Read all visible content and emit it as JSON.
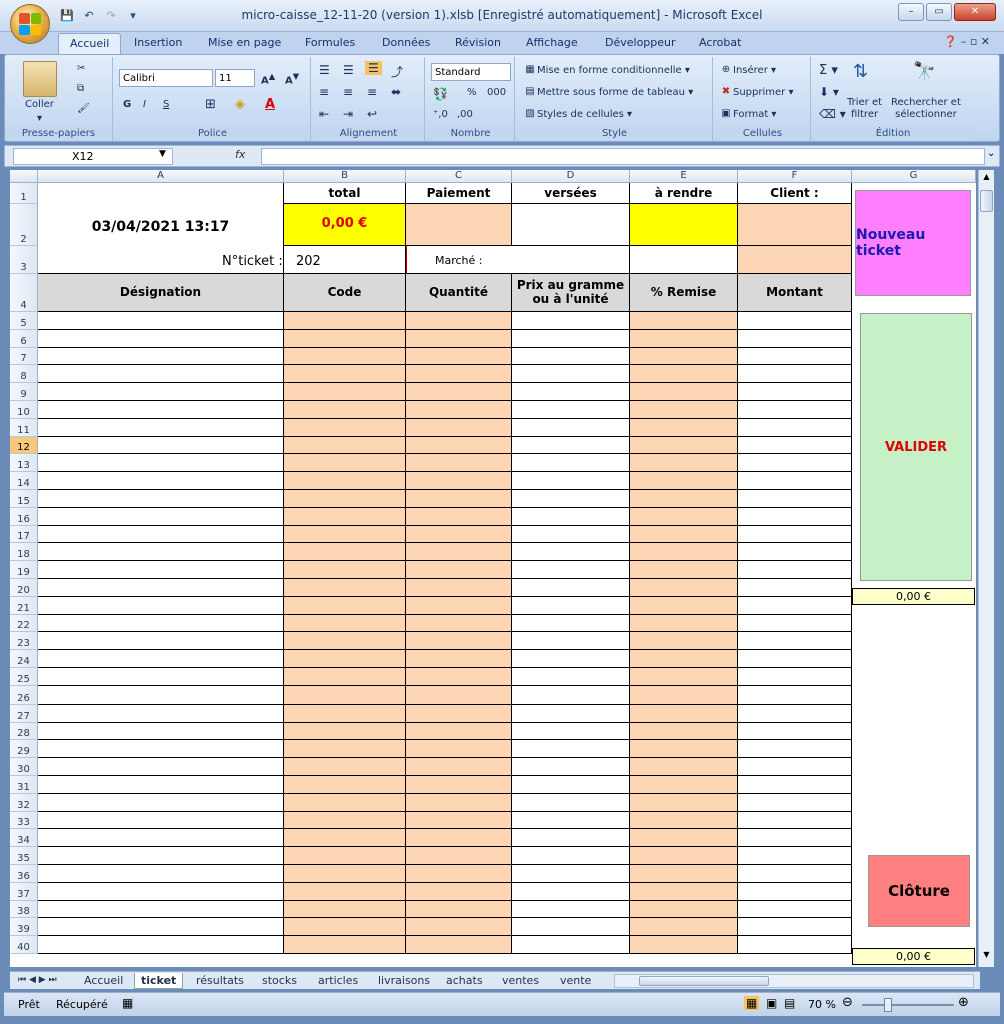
{
  "window": {
    "title": "micro-caisse_12-11-20 (version 1).xlsb [Enregistré automatiquement] - Microsoft Excel",
    "controls": [
      "–",
      "▭",
      "✕"
    ]
  },
  "ribbon": {
    "tabs": [
      "Accueil",
      "Insertion",
      "Mise en page",
      "Formules",
      "Données",
      "Révision",
      "Affichage",
      "Développeur",
      "Acrobat"
    ],
    "active_tab": "Accueil",
    "groups": {
      "clipboard": {
        "label": "Presse-papiers",
        "paste": "Coller"
      },
      "font": {
        "label": "Police",
        "font_name": "Calibri",
        "font_size": "11",
        "bold": "G",
        "italic": "I",
        "underline": "S"
      },
      "alignment": {
        "label": "Alignement"
      },
      "number": {
        "label": "Nombre",
        "format": "Standard",
        "percent": "%",
        "thousands": "000"
      },
      "style": {
        "label": "Style",
        "cond_format": "Mise en forme conditionnelle",
        "as_table": "Mettre sous forme de tableau",
        "cell_styles": "Styles de cellules"
      },
      "cells": {
        "label": "Cellules",
        "insert": "Insérer",
        "delete": "Supprimer",
        "format": "Format"
      },
      "editing": {
        "label": "Édition",
        "sort": "Trier et\nfiltrer",
        "find": "Rechercher et\nsélectionner",
        "sort_a": "Trier et",
        "sort_b": "filtrer",
        "find_a": "Rechercher et",
        "find_b": "sélectionner"
      }
    }
  },
  "formula_bar": {
    "name_box": "X12",
    "fx": "fx",
    "value": ""
  },
  "sheet": {
    "columns": [
      "A",
      "B",
      "C",
      "D",
      "E",
      "F",
      "G"
    ],
    "selected_row": 12,
    "datetime": "03/04/2021 13:17",
    "headers_row1": {
      "total": "total",
      "paiement": "Paiement",
      "versees": "versées",
      "a_rendre": "à rendre",
      "client": "Client :"
    },
    "total_value": "0,00 €",
    "ticket_label": "N°ticket :",
    "ticket_number": "202",
    "marche_label": "Marché :",
    "table_headers": {
      "designation": "Désignation",
      "code": "Code",
      "quantite": "Quantité",
      "prix_a": "Prix au gramme",
      "prix_b": "ou à l'unité",
      "remise": "% Remise",
      "montant": "Montant"
    },
    "buttons": {
      "nouveau_ticket": "Nouveau ticket",
      "valider": "VALIDER",
      "cloture": "Clôture"
    },
    "g20_value": "0,00 €",
    "g40_value": "0,00 €"
  },
  "sheet_tabs": [
    "Accueil",
    "ticket",
    "résultats",
    "stocks",
    "articles",
    "livraisons",
    "achats",
    "ventes",
    "vente"
  ],
  "active_sheet": "ticket",
  "status": {
    "ready": "Prêt",
    "recovered": "Récupéré",
    "zoom": "70 %"
  },
  "colors": {
    "salmon": "#fcd5b4",
    "yellow": "#ffff00",
    "pink_button": "#ff7fff",
    "green_button": "#c6f0c6",
    "red_button": "#ff8080",
    "red_text": "#e00000"
  }
}
